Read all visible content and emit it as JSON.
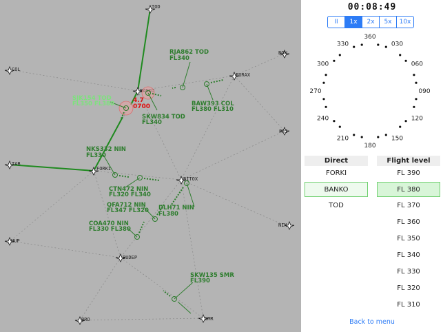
{
  "clock": "00:08:49",
  "speeds": [
    "II",
    "1x",
    "2x",
    "5x",
    "10x"
  ],
  "active_speed": "1x",
  "headings": [
    "360",
    "030",
    "060",
    "090",
    "120",
    "150",
    "180",
    "210",
    "240",
    "270",
    "300",
    "330"
  ],
  "fixes": {
    "tod": "TOD",
    "bow": "BOW",
    "col": "COL",
    "furax": "FURAX",
    "banko": "BANKO",
    "pri": "PRI",
    "tab": "TAB",
    "forki": "FORKI",
    "bitox": "BITOX",
    "nin": "NIN",
    "nup": "NUP",
    "budep": "BUDEP",
    "bro": "BRO",
    "smr": "SMR"
  },
  "flights": {
    "rja862": {
      "line1": "RJA862 TOD",
      "line2": "FL340"
    },
    "baw393": {
      "line1": "BAW393 COL",
      "line2": "FL380 FL310"
    },
    "sjk": {
      "line1": "SJK154 TOD",
      "line2": "FL350 FL380"
    },
    "skw834": {
      "line1": "SKW834 TOD",
      "line2": "FL340"
    },
    "nks332": {
      "line1": "NKS332 NIN",
      "line2": "FL330"
    },
    "ctn472": {
      "line1": "CTN472 NIN",
      "line2": "FL320 FL340"
    },
    "qfa712": {
      "line1": "QFA712 NIN",
      "line2": "FL347 FL320"
    },
    "dlh71": {
      "line1": "DLH71 NIN",
      "line2": "FL380"
    },
    "coa470": {
      "line1": "COA470 NIN",
      "line2": "FL330 FL380"
    },
    "skw135": {
      "line1": "SKW135 SMR",
      "line2": "FL390"
    }
  },
  "conflict": {
    "distance": "4.7",
    "time": "0700"
  },
  "direct": {
    "header": "Direct",
    "options": [
      "FORKI",
      "BANKO",
      "TOD"
    ],
    "selected": "BANKO"
  },
  "flight_level": {
    "header": "Flight level",
    "options": [
      "FL 390",
      "FL 380",
      "FL 370",
      "FL 360",
      "FL 350",
      "FL 340",
      "FL 330",
      "FL 320",
      "FL 310"
    ],
    "selected": "FL 380"
  },
  "back_label": "Back to menu",
  "colors": {
    "radar_bg": "#b4b4b4",
    "route": "#1f8a1f",
    "aircraft": "#2e7d2e",
    "conflict": "#e01010",
    "accent": "#2d7cf6",
    "selected": "#6fd06f"
  }
}
